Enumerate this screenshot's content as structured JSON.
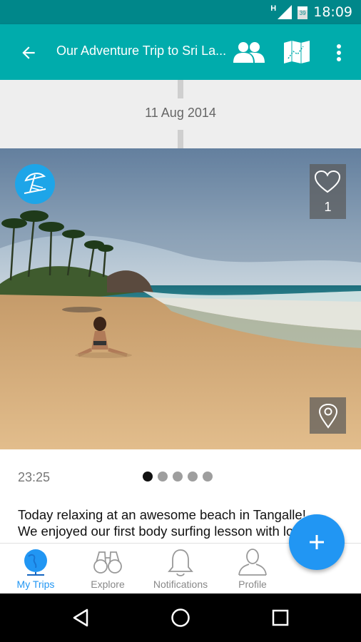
{
  "status_bar": {
    "time": "18:09",
    "network": "H",
    "calendar_day": "39"
  },
  "app_bar": {
    "title": "Our Adventure Trip to Sri La..."
  },
  "entry": {
    "date": "11 Aug 2014",
    "likes": "1",
    "time": "23:25",
    "photo_count": 5,
    "active_photo": 1,
    "caption_line1": "Today relaxing at an awesome beach in Tangalle!",
    "caption_line2": "We enjoyed our first body surfing lesson with local"
  },
  "bottom_nav": {
    "items": [
      {
        "label": "My Trips",
        "icon": "globe-icon"
      },
      {
        "label": "Explore",
        "icon": "binoculars-icon"
      },
      {
        "label": "Notifications",
        "icon": "bell-icon"
      },
      {
        "label": "Profile",
        "icon": "person-icon"
      }
    ],
    "active_index": 0
  },
  "colors": {
    "status_bar": "#00878a",
    "app_bar": "#00acac",
    "accent": "#2196f3",
    "badge": "#1ea5e8"
  }
}
